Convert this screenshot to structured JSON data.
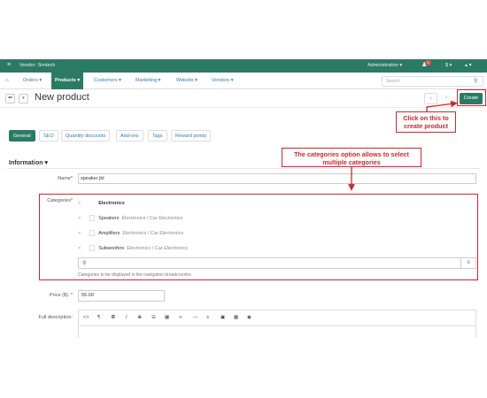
{
  "topbar": {
    "vendor": "Vendor: Simtech",
    "admin": "Administration ▾",
    "notification_count": "2",
    "currency": "$ ▾",
    "user": "▴ ▾"
  },
  "nav": {
    "items": [
      "Orders ▾",
      "Products ▾",
      "Customers ▾",
      "Marketing ▾",
      "Website ▾",
      "Vendors ▾"
    ],
    "active": "Products ▾",
    "search_placeholder": "Search"
  },
  "page": {
    "title": "New product",
    "create_label": "Create"
  },
  "tabs": [
    "General",
    "SEO",
    "Quantity discounts",
    "Add-ons",
    "Tags",
    "Reward points"
  ],
  "section": {
    "title": "Information ▾"
  },
  "form": {
    "name_label": "Name",
    "name_value": "speaker jbl",
    "categories_label": "Categories",
    "categories": [
      {
        "name": "Electronics",
        "path": ""
      },
      {
        "name": "Speakers",
        "path": "Electronics / Car Electronics"
      },
      {
        "name": "Amplifiers",
        "path": "Electronics / Car Electronics"
      },
      {
        "name": "Subwoofers",
        "path": "Electronics / Car Electronics"
      }
    ],
    "categories_hint": "Categories to be displayed in the navigation breadcrumbs.",
    "price_label": "Price ($):",
    "price_value": "55.00",
    "description_label": "Full description:"
  },
  "callouts": {
    "create": "Click on this to create product",
    "categories": "The categories option allows to select multiple categories"
  },
  "colors": {
    "brand": "#2b7a63",
    "link": "#2e7ab8",
    "annotation": "#d0262e"
  }
}
